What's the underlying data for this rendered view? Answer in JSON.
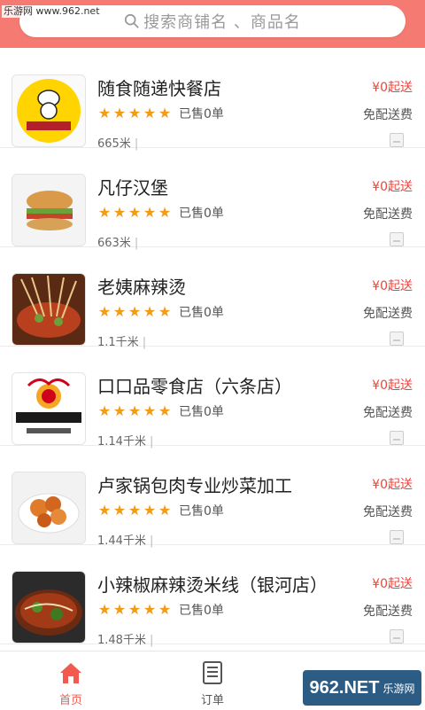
{
  "watermark_top": "乐游网 www.962.net",
  "search": {
    "placeholder": "搜索商铺名 、商品名"
  },
  "colors": {
    "accent": "#f47a72",
    "price": "#e8453c",
    "star": "#f39a16"
  },
  "stores": [
    {
      "name": "随食随递快餐店",
      "rating": 5,
      "sold": "已售0单",
      "distance": "665米",
      "min_order": "¥0起送",
      "delivery": "免配送费",
      "thumb": "logo-chef"
    },
    {
      "name": "凡仔汉堡",
      "rating": 5,
      "sold": "已售0单",
      "distance": "663米",
      "min_order": "¥0起送",
      "delivery": "免配送费",
      "thumb": "burger"
    },
    {
      "name": "老姨麻辣烫",
      "rating": 5,
      "sold": "已售0单",
      "distance": "1.1千米",
      "min_order": "¥0起送",
      "delivery": "免配送费",
      "thumb": "skewers"
    },
    {
      "name": "口口品零食店（六条店）",
      "rating": 5,
      "sold": "已售0单",
      "distance": "1.14千米",
      "min_order": "¥0起送",
      "delivery": "免配送费",
      "thumb": "koukoupin-logo"
    },
    {
      "name": "卢家锅包肉专业炒菜加工",
      "rating": 5,
      "sold": "已售0单",
      "distance": "1.44千米",
      "min_order": "¥0起送",
      "delivery": "免配送费",
      "thumb": "fried-pork"
    },
    {
      "name": "小辣椒麻辣烫米线（银河店）",
      "rating": 5,
      "sold": "已售0单",
      "distance": "1.48千米",
      "min_order": "¥0起送",
      "delivery": "免配送费",
      "thumb": "noodle-bowl"
    }
  ],
  "tabs": [
    {
      "label": "首页",
      "icon": "home-icon",
      "active": true
    },
    {
      "label": "订单",
      "icon": "order-list-icon",
      "active": false
    }
  ],
  "watermark_bottom": {
    "brand": "962.NET",
    "sub": "乐游网"
  }
}
